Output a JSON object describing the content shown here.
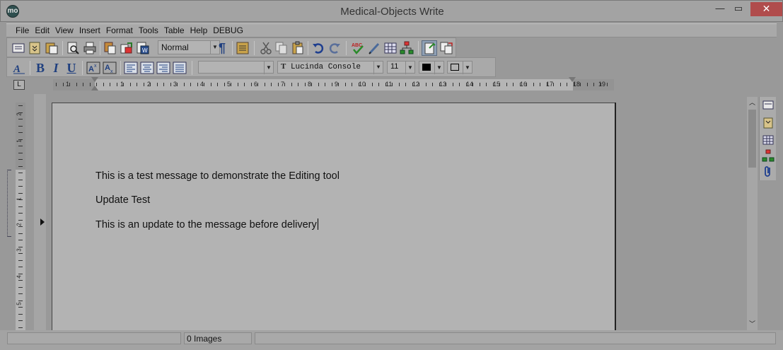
{
  "window": {
    "title": "Medical-Objects Write",
    "app_icon_glyph": "mo",
    "minimize_glyph": "—",
    "maximize_glyph": "▭",
    "close_glyph": "✕"
  },
  "menu": {
    "items": [
      "File",
      "Edit",
      "View",
      "Insert",
      "Format",
      "Tools",
      "Table",
      "Help",
      "DEBUG"
    ]
  },
  "toolbar1": {
    "style_value": "Normal",
    "icons": [
      "page-view-icon",
      "fields-icon",
      "paste-special-icon",
      "print-preview-icon",
      "print-icon",
      "copy-format-icon",
      "merge-icon",
      "word-export-icon",
      "pilcrow-icon",
      "style-list-icon",
      "cut-icon",
      "copy-icon",
      "paste-icon",
      "undo-icon",
      "redo-icon",
      "spellcheck-icon",
      "pen-icon",
      "table-grid-icon",
      "tree-icon",
      "track-changes-icon",
      "compare-icon"
    ],
    "pilcrow_glyph": "¶"
  },
  "toolbar2": {
    "bold_glyph": "B",
    "italic_glyph": "I",
    "underline_glyph": "U",
    "font_name": "Lucinda Console",
    "font_size": "11",
    "truetype_glyph": "T"
  },
  "ruler": {
    "corner_glyph": "L",
    "numbers": [
      "1",
      "1",
      "2",
      "3",
      "4",
      "5",
      "6",
      "7",
      "8",
      "9",
      "10",
      "11",
      "12",
      "13",
      "14",
      "15",
      "16",
      "17",
      "18",
      "19"
    ],
    "vertical_numbers": [
      "2",
      "1",
      "1",
      "2",
      "3",
      "4",
      "5"
    ]
  },
  "document": {
    "lines": [
      "This is a test message to demonstrate the Editing tool",
      "Update Test",
      "This is an update to the message before delivery"
    ]
  },
  "scrollbar": {
    "up_glyph": "︿",
    "down_glyph": "﹀"
  },
  "statusbar": {
    "cell1": "",
    "images": "0 Images",
    "cell3": ""
  },
  "colors": {
    "background": "#999999",
    "close_button": "#b04c4c",
    "font_color_swatch": "#000000",
    "highlight_swatch": "#b3b3b3"
  }
}
